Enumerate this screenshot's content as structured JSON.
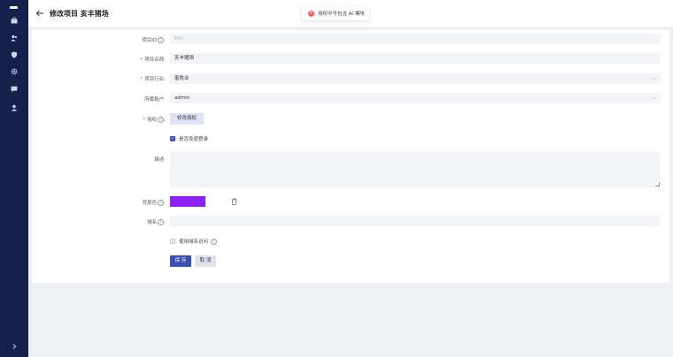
{
  "header": {
    "title": "修改项目 亥丰猪场"
  },
  "toast": {
    "icon": "error-icon",
    "text": "授权中不包含 AI 模块"
  },
  "sidebar": {
    "icons": [
      "briefcase-icon",
      "users-icon",
      "shield-icon",
      "gear-icon",
      "message-icon",
      "user-icon"
    ],
    "expand_icon": "chevron-right-icon"
  },
  "form": {
    "project_id": {
      "label": "项目ID",
      "placeholder": "Mio"
    },
    "project_name": {
      "label": "项目名称:",
      "value": "亥丰猪场"
    },
    "industry": {
      "label": "项目行业:",
      "value": "畜牧业"
    },
    "tenant": {
      "label": "所属租户:",
      "value": "admin"
    },
    "license": {
      "label": "授权",
      "button": "修改授权"
    },
    "allow_anonymous": {
      "label": "是否免密登录",
      "checked": true
    },
    "description": {
      "label": "描述:",
      "value": ""
    },
    "theme_color": {
      "label": "背景色",
      "value": "#8a21f5"
    },
    "domain": {
      "label": "域名",
      "value": ""
    },
    "use_domain": {
      "label": "使用域名访问",
      "checked": false
    },
    "save_label": "保 存",
    "cancel_label": "取 消"
  }
}
